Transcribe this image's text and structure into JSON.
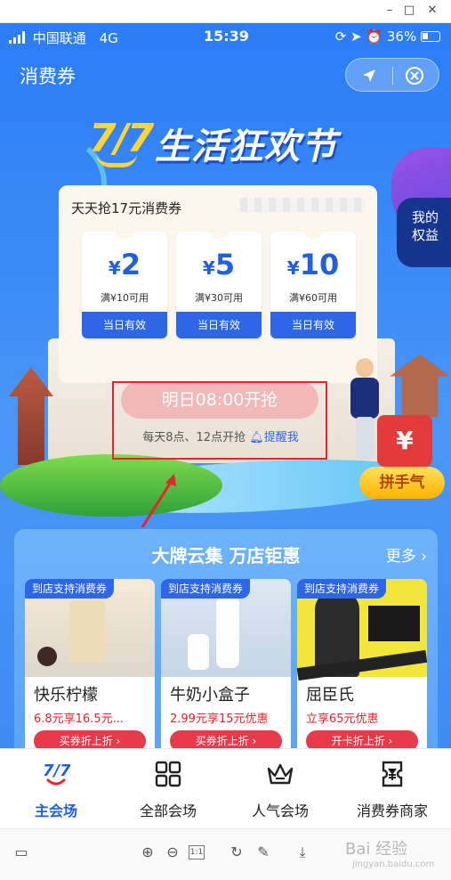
{
  "status_bar": {
    "carrier": "中国联通",
    "network": "4G",
    "time": "15:39",
    "battery": "36%"
  },
  "navbar": {
    "title": "消费券",
    "location_icon": "navigation-arrow-icon",
    "close_icon": "close-circle-icon"
  },
  "banner": {
    "brand_number": "7/7",
    "brand_text": "生活狂欢节"
  },
  "side_badge": {
    "label_line1": "我的",
    "label_line2": "权益"
  },
  "coupon_card": {
    "title": "天天抢17元消费券",
    "coupons": [
      {
        "symbol": "¥",
        "amount": "2",
        "condition": "满¥10可用",
        "validity": "当日有效"
      },
      {
        "symbol": "¥",
        "amount": "5",
        "condition": "满¥30可用",
        "validity": "当日有效"
      },
      {
        "symbol": "¥",
        "amount": "10",
        "condition": "满¥60可用",
        "validity": "当日有效"
      }
    ],
    "grab_button": "明日08:00开抢",
    "schedule_text": "每天8点、12点开抢",
    "remind_link": "提醒我"
  },
  "group_buy": {
    "redpack_symbol": "¥",
    "button": "拼手气"
  },
  "promo": {
    "title": "大牌云集 万店钜惠",
    "more": "更多",
    "shops": [
      {
        "tag": "到店支持消费券",
        "name": "快乐柠檬",
        "price": "6.8元享16.5元...",
        "button": "买券折上折 ›"
      },
      {
        "tag": "到店支持消费券",
        "name": "牛奶小盒子",
        "price": "2.99元享15元优惠",
        "button": "买券折上折 ›"
      },
      {
        "tag": "到店支持消费券",
        "name": "屈臣氏",
        "price": "立享65元优惠",
        "button": "开卡折上折 ›"
      }
    ]
  },
  "tabbar": {
    "tabs": [
      {
        "label": "主会场",
        "icon": "7-7-logo-icon",
        "active": true
      },
      {
        "label": "全部会场",
        "icon": "grid-icon",
        "active": false
      },
      {
        "label": "人气会场",
        "icon": "crown-icon",
        "active": false
      },
      {
        "label": "消费券商家",
        "icon": "ticket-icon",
        "active": false
      }
    ]
  },
  "viewer_toolbar": {
    "icons": [
      "thumbnail-icon",
      "zoom-in-icon",
      "zoom-out-icon",
      "actual-size-icon",
      "rotate-icon",
      "edit-icon",
      "download-icon"
    ],
    "actual_size_label": "1:1"
  },
  "watermark": {
    "main": "Bai 经验",
    "sub": "jingyan.baidu.com"
  },
  "colors": {
    "primary_blue": "#2d67e6",
    "highlight_red": "#e8232b",
    "brand_yellow": "#ffd534",
    "button_red": "#e83a4a"
  }
}
